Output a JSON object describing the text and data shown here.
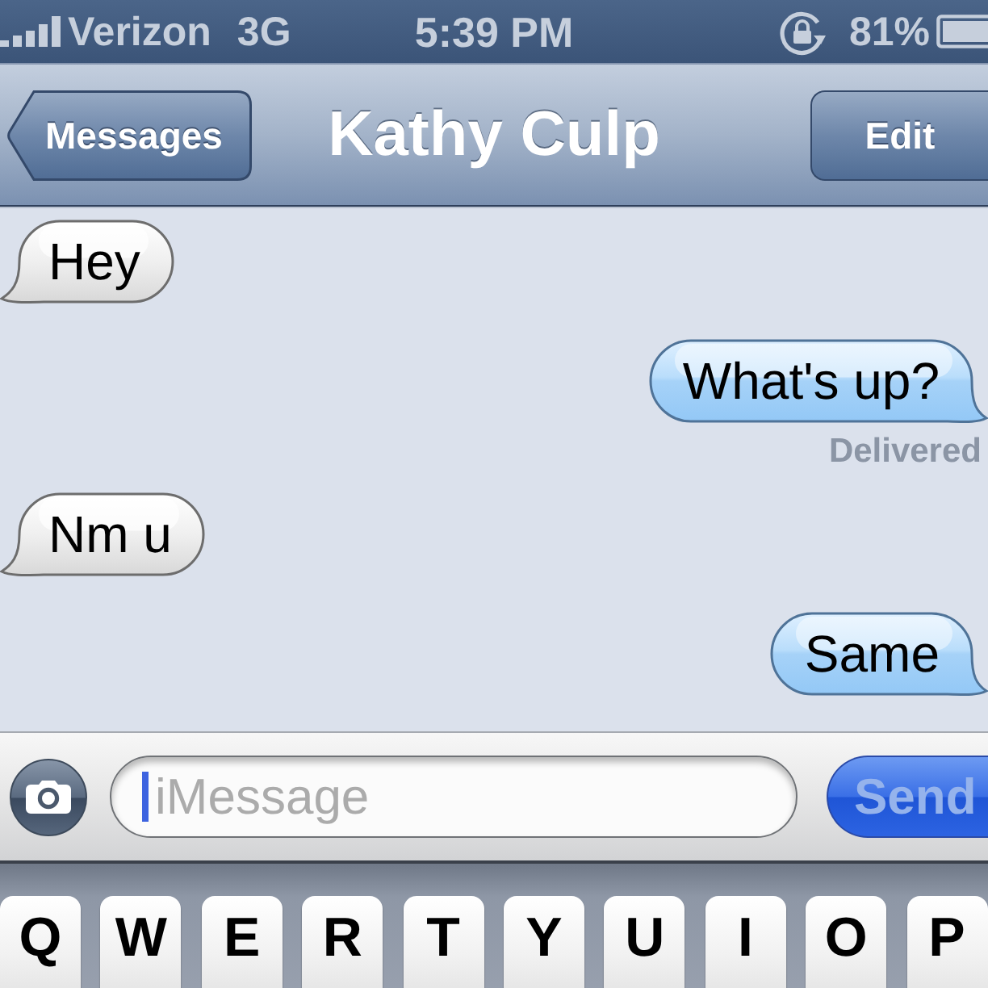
{
  "status_bar": {
    "carrier": "Verizon",
    "network": "3G",
    "time": "5:39 PM",
    "battery": "81%"
  },
  "nav_bar": {
    "back_button": "Messages",
    "title": "Kathy Culp",
    "edit_button": "Edit"
  },
  "messages": [
    {
      "kind": "received",
      "text": "Hey"
    },
    {
      "kind": "sent",
      "text": "What's up?",
      "status": "Delivered"
    },
    {
      "kind": "received",
      "text": "Nm u"
    },
    {
      "kind": "sent",
      "text": "Same"
    }
  ],
  "composer": {
    "placeholder": "iMessage",
    "send_button": {
      "label": "Send",
      "disabled": true
    }
  },
  "keyboard": {
    "keys": [
      "Q",
      "W",
      "E",
      "R",
      "T",
      "Y",
      "U",
      "I",
      "O",
      "P"
    ]
  }
}
